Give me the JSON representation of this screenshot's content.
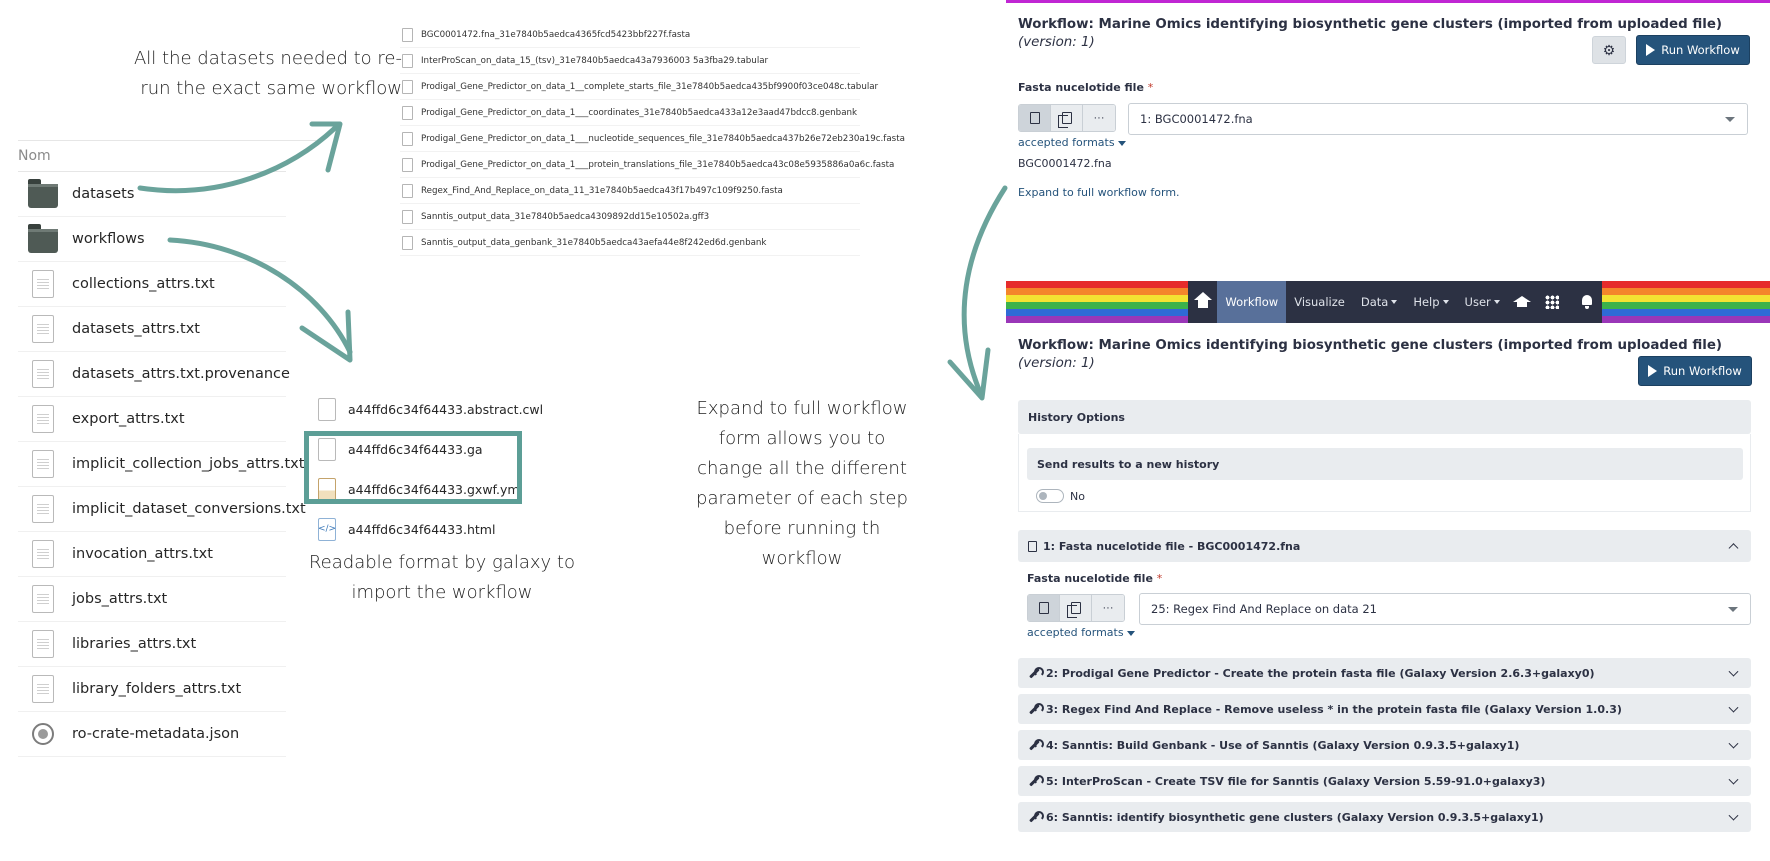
{
  "explorer": {
    "column_header": "Nom",
    "items": [
      {
        "name": "datasets",
        "type": "folder"
      },
      {
        "name": "workflows",
        "type": "folder"
      },
      {
        "name": "collections_attrs.txt",
        "type": "file"
      },
      {
        "name": "datasets_attrs.txt",
        "type": "file"
      },
      {
        "name": "datasets_attrs.txt.provenance",
        "type": "file"
      },
      {
        "name": "export_attrs.txt",
        "type": "file"
      },
      {
        "name": "implicit_collection_jobs_attrs.txt",
        "type": "file"
      },
      {
        "name": "implicit_dataset_conversions.txt",
        "type": "file"
      },
      {
        "name": "invocation_attrs.txt",
        "type": "file"
      },
      {
        "name": "jobs_attrs.txt",
        "type": "file"
      },
      {
        "name": "libraries_attrs.txt",
        "type": "file"
      },
      {
        "name": "library_folders_attrs.txt",
        "type": "file"
      },
      {
        "name": "ro-crate-metadata.json",
        "type": "crate"
      }
    ]
  },
  "datasets_folder": {
    "files": [
      "BGC0001472.fna_31e7840b5aedca4365fcd5423bbf227f.fasta",
      "InterProScan_on_data_15_(tsv)_31e7840b5aedca43a7936003 5a3fba29.tabular",
      "Prodigal_Gene_Predictor_on_data_1__complete_starts_file_31e7840b5aedca435bf9900f03ce048c.tabular",
      "Prodigal_Gene_Predictor_on_data_1___coordinates_31e7840b5aedca433a12e3aad47bdcc8.genbank",
      "Prodigal_Gene_Predictor_on_data_1___nucleotide_sequences_file_31e7840b5aedca437b26e72eb230a19c.fasta",
      "Prodigal_Gene_Predictor_on_data_1___protein_translations_file_31e7840b5aedca43c08e5935886a0a6c.fasta",
      "Regex_Find_And_Replace_on_data_11_31e7840b5aedca43f17b497c109f9250.fasta",
      "Sanntis_output_data_31e7840b5aedca4309892dd15e10502a.gff3",
      "Sanntis_output_data_genbank_31e7840b5aedca43aefa44e8f242ed6d.genbank"
    ]
  },
  "workflows_folder": {
    "files": [
      {
        "name": "a44ffd6c34f64433.abstract.cwl",
        "kind": "doc"
      },
      {
        "name": "a44ffd6c34f64433.ga",
        "kind": "doc"
      },
      {
        "name": "a44ffd6c34f64433.gxwf.yml",
        "kind": "yml"
      },
      {
        "name": "a44ffd6c34f64433.html",
        "kind": "html"
      }
    ]
  },
  "annotations": {
    "datasets_note": "All the datasets needed to re-run the exact same workflow",
    "readable_note": "Readable format by galaxy to import the workflow",
    "expand_note": "Expand to full workflow form allows you to change all the different parameter of each step before running th workflow",
    "arrow_color": "#6aa39b"
  },
  "simple_form": {
    "title": "Workflow: Marine Omics identifying biosynthetic gene clusters (imported from uploaded file)",
    "version": "(version: 1)",
    "run_label": "Run Workflow",
    "settings_icon": "gear-icon",
    "input_label": "Fasta nucelotide file",
    "required_mark": "*",
    "selected": "1: BGC0001472.fna",
    "accepted_formats": "accepted formats",
    "dataset_name": "BGC0001472.fna",
    "expand_link": "Expand to full workflow form."
  },
  "masthead": {
    "items": [
      {
        "label": "Workflow",
        "active": true,
        "dropdown": false
      },
      {
        "label": "Visualize",
        "active": false,
        "dropdown": false
      },
      {
        "label": "Data",
        "active": false,
        "dropdown": true
      },
      {
        "label": "Help",
        "active": false,
        "dropdown": true
      },
      {
        "label": "User",
        "active": false,
        "dropdown": true
      }
    ],
    "bar_color": "#2c3143",
    "active_color": "#58709a"
  },
  "full_form": {
    "title": "Workflow: Marine Omics identifying biosynthetic gene clusters (imported from uploaded file)",
    "version": "(version: 1)",
    "run_label": "Run Workflow",
    "history_options": "History Options",
    "send_new_history": "Send results to a new history",
    "toggle_value": "No",
    "step1": "1: Fasta nucelotide file - BGC0001472.fna",
    "step1_input_label": "Fasta nucelotide file",
    "required_mark": "*",
    "step1_selected": "25: Regex Find And Replace on data 21",
    "accepted_formats": "accepted formats",
    "steps": [
      "2: Prodigal Gene Predictor - Create the protein fasta file (Galaxy Version 2.6.3+galaxy0)",
      "3: Regex Find And Replace - Remove useless * in the protein fasta file (Galaxy Version 1.0.3)",
      "4: Sanntis: Build Genbank - Use of Sanntis (Galaxy Version 0.9.3.5+galaxy1)",
      "5: InterProScan - Create TSV file for Sanntis (Galaxy Version 5.59-91.0+galaxy3)",
      "6: Sanntis: identify biosynthetic gene clusters (Galaxy Version 0.9.3.5+galaxy1)"
    ],
    "brand_color": "#25537b"
  }
}
